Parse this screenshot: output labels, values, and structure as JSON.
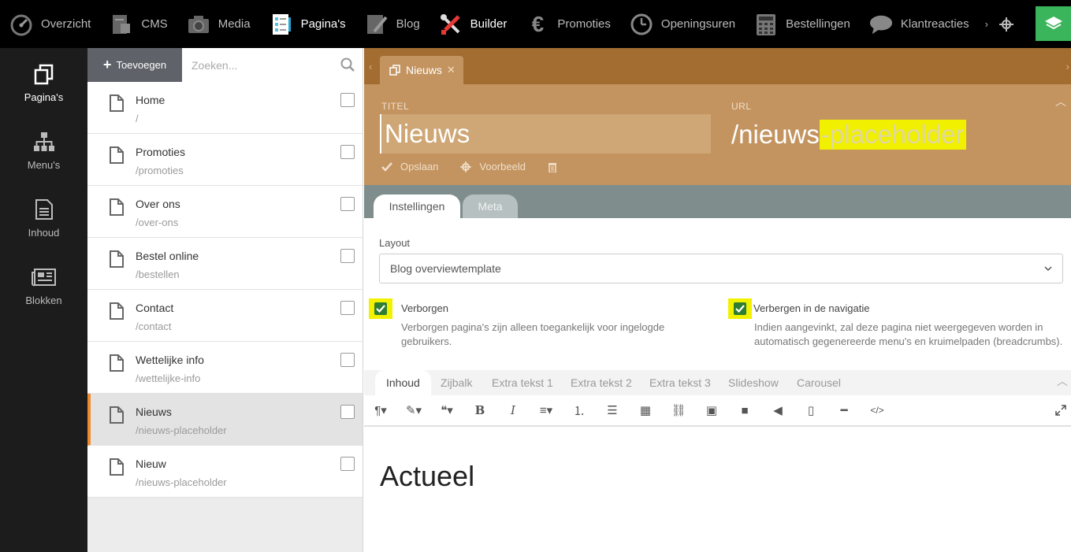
{
  "topnav": {
    "items": [
      {
        "label": "Overzicht",
        "icon": "dashboard-icon"
      },
      {
        "label": "CMS",
        "icon": "cms-icon"
      },
      {
        "label": "Media",
        "icon": "camera-icon"
      },
      {
        "label": "Pagina's",
        "icon": "pages-checklist-icon"
      },
      {
        "label": "Blog",
        "icon": "blog-pencil-icon"
      },
      {
        "label": "Builder",
        "icon": "tools-icon"
      },
      {
        "label": "Promoties",
        "icon": "euro-icon"
      },
      {
        "label": "Openingsuren",
        "icon": "clock-icon"
      },
      {
        "label": "Bestellingen",
        "icon": "calculator-icon"
      },
      {
        "label": "Klantreacties",
        "icon": "speech-bubble-icon"
      }
    ],
    "active": "Pagina's"
  },
  "sidebar": {
    "items": [
      {
        "label": "Pagina's",
        "icon": "pages-copy-icon"
      },
      {
        "label": "Menu's",
        "icon": "sitemap-icon"
      },
      {
        "label": "Inhoud",
        "icon": "document-text-icon"
      },
      {
        "label": "Blokken",
        "icon": "newspaper-icon"
      }
    ]
  },
  "pagelist": {
    "add_label": "Toevoegen",
    "search_placeholder": "Zoeken...",
    "pages": [
      {
        "name": "Home",
        "url": "/"
      },
      {
        "name": "Promoties",
        "url": "/promoties"
      },
      {
        "name": "Over ons",
        "url": "/over-ons"
      },
      {
        "name": "Bestel online",
        "url": "/bestellen"
      },
      {
        "name": "Contact",
        "url": "/contact"
      },
      {
        "name": "Wettelijke info",
        "url": "/wettelijke-info"
      },
      {
        "name": "Nieuws",
        "url": "/nieuws-placeholder"
      },
      {
        "name": "Nieuw",
        "url": "/nieuws-placeholder"
      }
    ]
  },
  "main": {
    "doc_tab": "Nieuws",
    "title_label": "TITEL",
    "url_label": "URL",
    "title_value": "Nieuws",
    "url_prefix": "/nieuws",
    "url_highlight": "-placeholder",
    "save_label": "Opslaan",
    "preview_label": "Voorbeeld",
    "settings_tabs": [
      "Instellingen",
      "Meta"
    ],
    "layout_label": "Layout",
    "layout_value": "Blog overviewtemplate",
    "hidden": {
      "label": "Verborgen",
      "help": "Verborgen pagina's zijn alleen toegankelijk voor ingelogde gebruikers."
    },
    "nav_hidden": {
      "label": "Verbergen in de navigatie",
      "help": "Indien aangevinkt, zal deze pagina niet weergegeven worden in automatisch gegenereerde menu's en kruimelpaden (breadcrumbs)."
    },
    "editor_tabs": [
      "Inhoud",
      "Zijbalk",
      "Extra tekst 1",
      "Extra tekst 2",
      "Extra tekst 3",
      "Slideshow",
      "Carousel"
    ],
    "editor_heading": "Actueel"
  },
  "colors": {
    "accent_orange": "#ef8a2e",
    "header_brown": "#a36d32",
    "header_tan": "#c39460",
    "green": "#3bb55b",
    "highlight_yellow": "#f2f200"
  }
}
